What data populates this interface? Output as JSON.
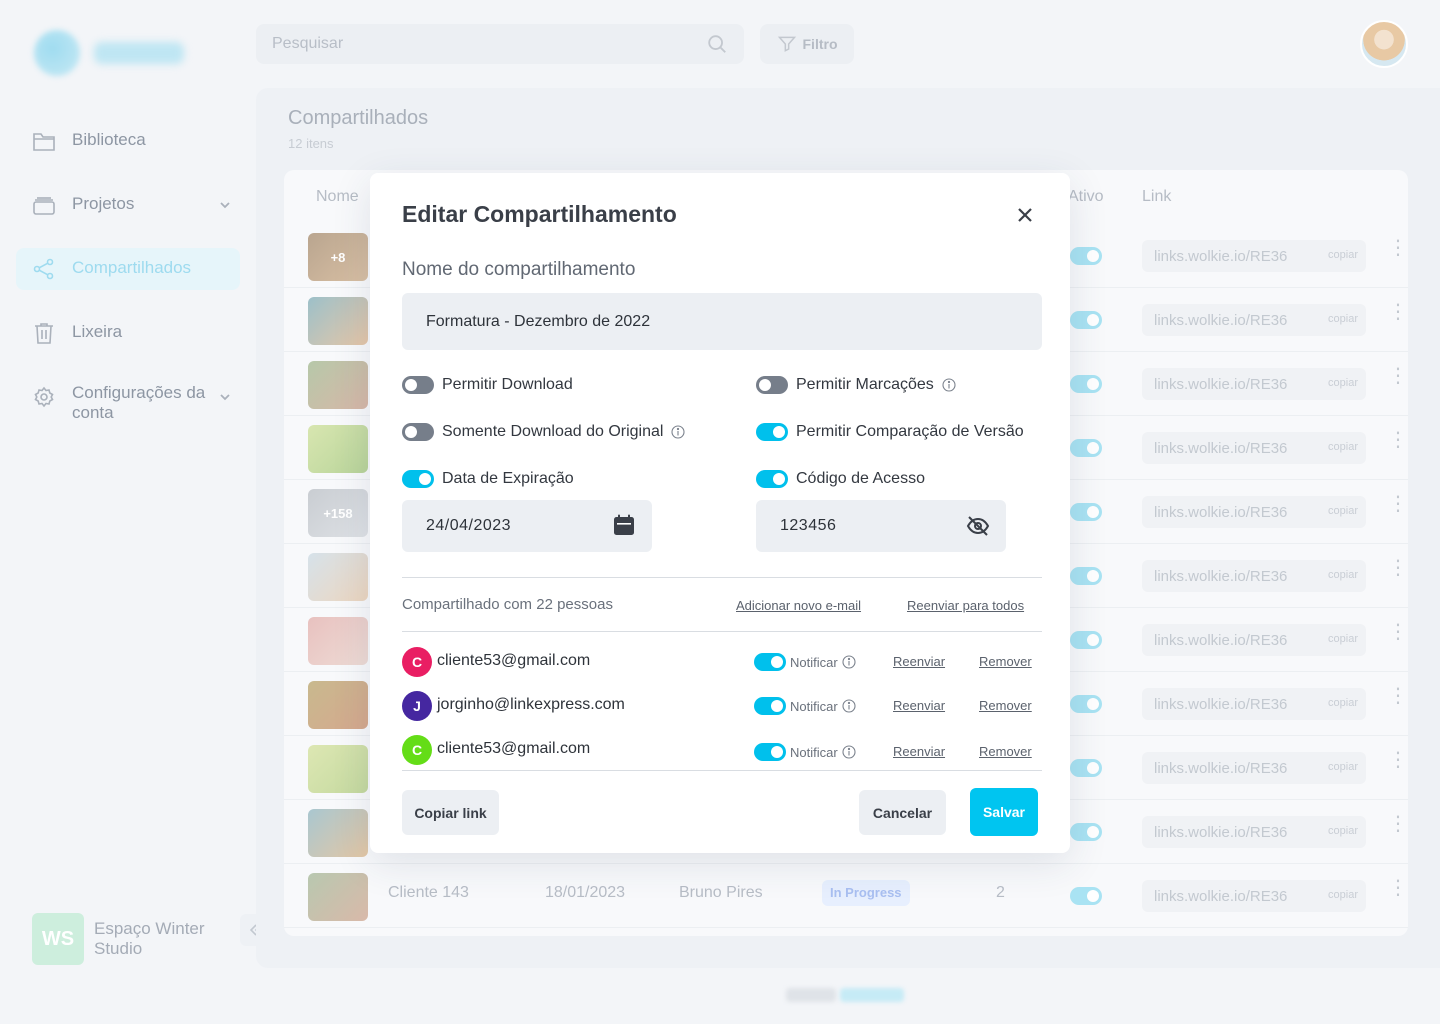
{
  "search": {
    "placeholder": "Pesquisar"
  },
  "filter": {
    "label": "Filtro"
  },
  "sidebar": {
    "items": [
      {
        "label": "Biblioteca"
      },
      {
        "label": "Projetos"
      },
      {
        "label": "Compartilhados"
      },
      {
        "label": "Lixeira"
      },
      {
        "label": "Configurações da conta"
      }
    ],
    "workspace": {
      "initials": "WS",
      "name": "Espaço Winter Studio"
    }
  },
  "page": {
    "title": "Compartilhados",
    "subtitle": "12 itens"
  },
  "table": {
    "headers": {
      "name": "Nome",
      "active": "Ativo",
      "link": "Link"
    },
    "link_text": "links.wolkie.io/RE36",
    "copy_label": "copiar",
    "thumb_badges": [
      "+8",
      "+158"
    ],
    "last_row": {
      "name": "Cliente 143",
      "date": "18/01/2023",
      "owner": "Bruno Pires",
      "status": "In Progress",
      "count": "2"
    }
  },
  "modal": {
    "title": "Editar Compartilhamento",
    "name_label": "Nome do compartilhamento",
    "name_value": "Formatura - Dezembro de 2022",
    "options": {
      "allow_download": {
        "label": "Permitir Download",
        "on": false
      },
      "allow_marks": {
        "label": "Permitir Marcações",
        "on": false
      },
      "original_only": {
        "label": "Somente Download do Original",
        "on": false
      },
      "version_compare": {
        "label": "Permitir Comparação de Versão",
        "on": true
      },
      "expiration": {
        "label": "Data de Expiração",
        "on": true
      },
      "access_code": {
        "label": "Código de Acesso",
        "on": true
      }
    },
    "expiration_date": "24/04/2023",
    "access_code_value": "123456",
    "shared_count": "Compartilhado com 22 pessoas",
    "add_email": "Adicionar novo e-mail",
    "resend_all": "Reenviar para todos",
    "notify_label": "Notificar",
    "resend_label": "Reenviar",
    "remove_label": "Remover",
    "people": [
      {
        "initial": "C",
        "email": "cliente53@gmail.com",
        "color": "#e91e63"
      },
      {
        "initial": "J",
        "email": "jorginho@linkexpress.com",
        "color": "#4527a0"
      },
      {
        "initial": "C",
        "email": "cliente53@gmail.com",
        "color": "#64dd17"
      }
    ],
    "buttons": {
      "copy_link": "Copiar link",
      "cancel": "Cancelar",
      "save": "Salvar"
    }
  },
  "colors": {
    "accent": "#00c5f0",
    "toggle_on": "#00c0ec",
    "toggle_off": "#767e8a"
  }
}
